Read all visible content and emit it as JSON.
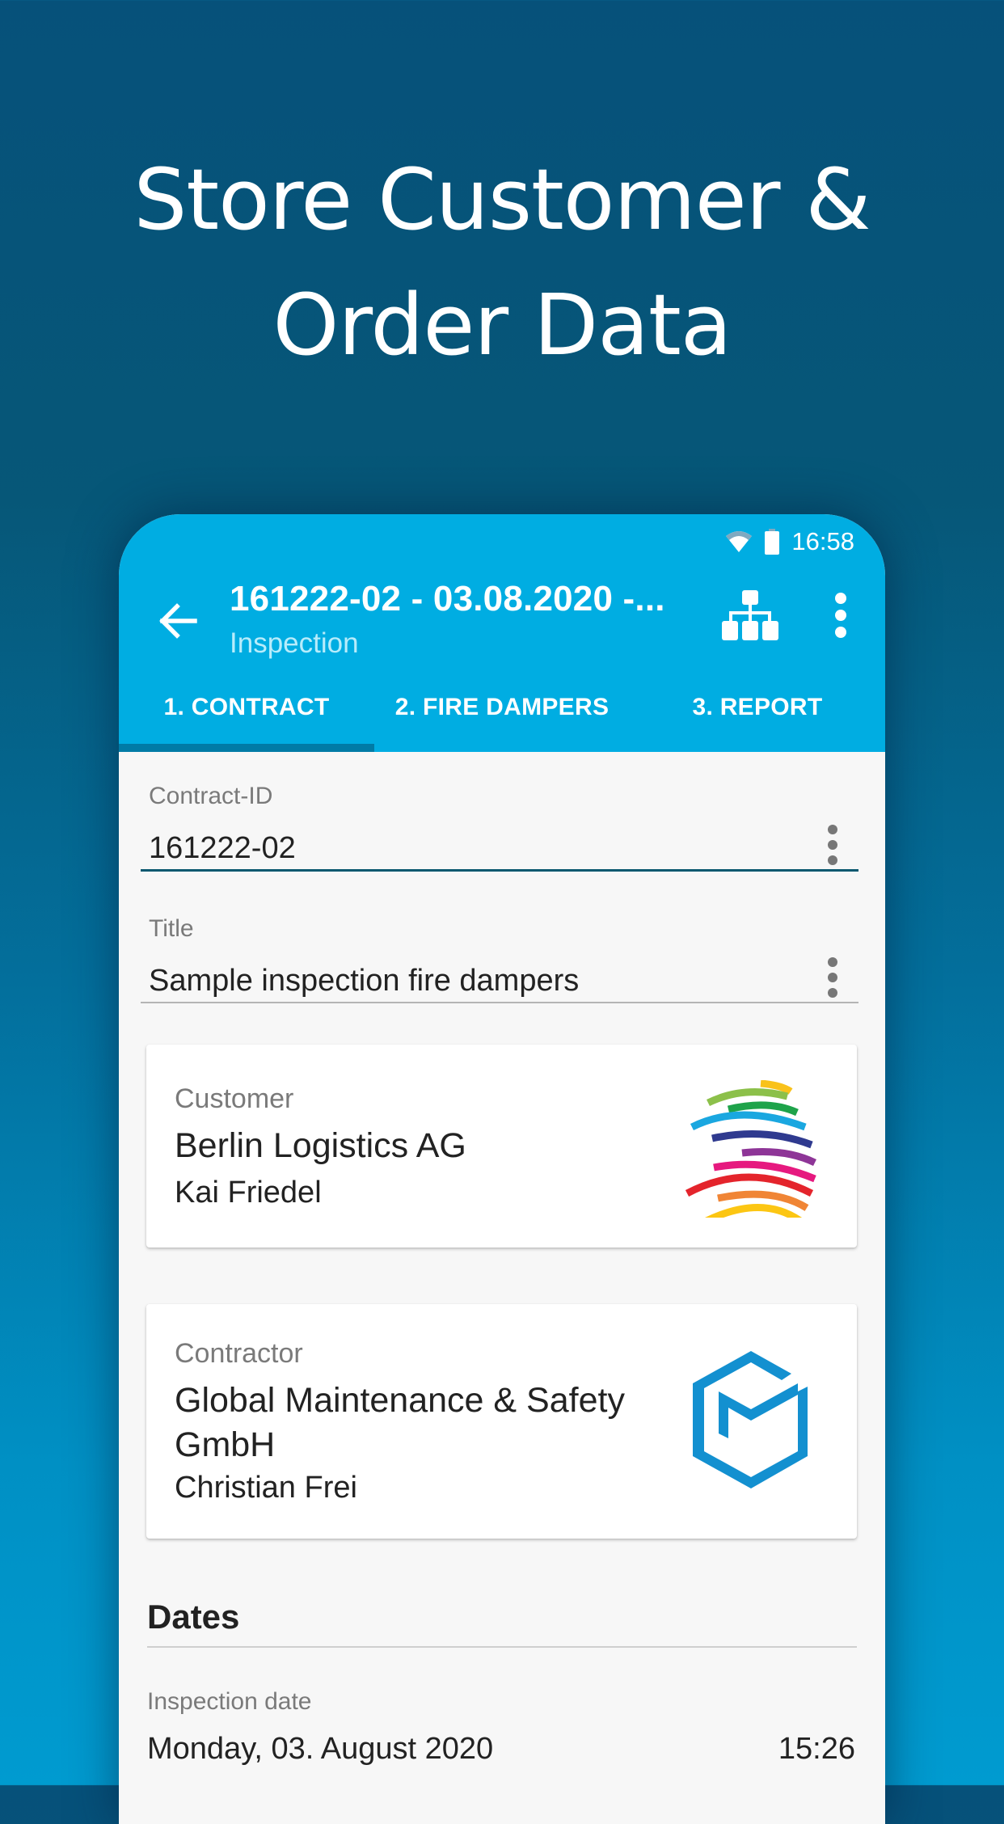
{
  "headline": {
    "line1": "Store Customer &",
    "line2": "Order Data"
  },
  "status_bar": {
    "time": "16:58",
    "icons": [
      "wifi-icon",
      "battery-icon"
    ]
  },
  "toolbar": {
    "title": "161222-02 - 03.08.2020 -...",
    "subtitle": "Inspection",
    "icons": [
      "back-arrow-icon",
      "hierarchy-icon",
      "more-vert-icon"
    ]
  },
  "tabs": [
    {
      "label": "1. CONTRACT",
      "active": true
    },
    {
      "label": "2. FIRE DAMPERS",
      "active": false
    },
    {
      "label": "3. REPORT",
      "active": false
    }
  ],
  "form": {
    "contract_id": {
      "label": "Contract-ID",
      "value": "161222-02"
    },
    "title": {
      "label": "Title",
      "value": "Sample inspection fire dampers"
    }
  },
  "customer": {
    "label": "Customer",
    "company": "Berlin Logistics AG",
    "contact": "Kai Friedel",
    "logo": "rainbow-globe-logo"
  },
  "contractor": {
    "label": "Contractor",
    "company": "Global Maintenance & Safety GmbH",
    "contact": "Christian Frei",
    "logo": "hexagon-gm-logo"
  },
  "dates": {
    "section_title": "Dates",
    "inspection_date": {
      "label": "Inspection date",
      "date": "Monday, 03. August 2020",
      "time": "15:26"
    }
  },
  "colors": {
    "primary": "#00ade2",
    "tab_indicator": "#007ba6",
    "focused_underline": "#0b5870",
    "background_top": "#06517a",
    "background_bottom": "#009bd0",
    "contractor_logo": "#1390d0"
  }
}
